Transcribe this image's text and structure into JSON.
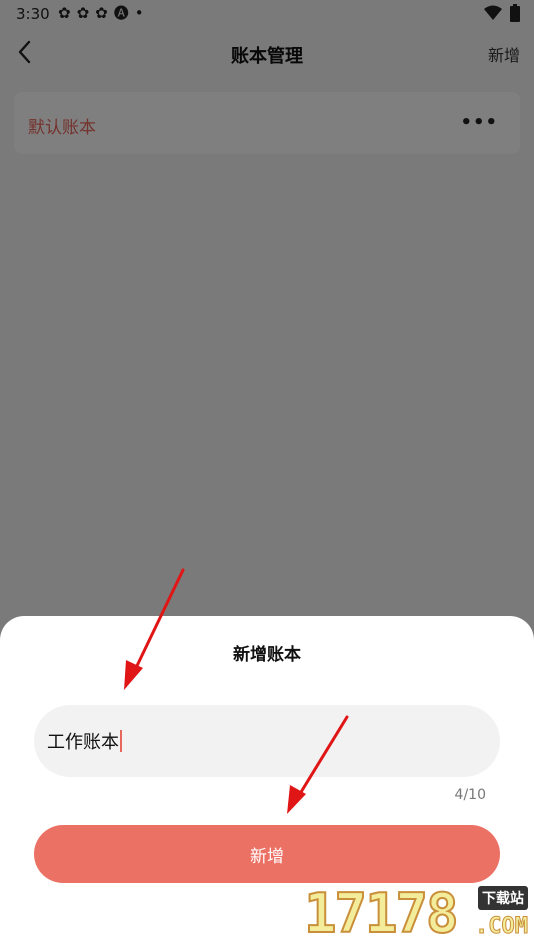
{
  "status_bar": {
    "time": "3:30",
    "left_icons": [
      "status-app-icon",
      "status-app-icon",
      "status-app-icon",
      "status-a-icon",
      "status-dot-icon"
    ],
    "right_icons": [
      "wifi-icon",
      "battery-icon"
    ]
  },
  "nav": {
    "title": "账本管理",
    "action_label": "新增"
  },
  "books": [
    {
      "name": "默认账本"
    }
  ],
  "dialog": {
    "title": "新增账本",
    "input_value": "工作账本",
    "char_count": "4/10",
    "submit_label": "新增"
  },
  "watermark": {
    "digits": "17178",
    "badge": "下载站",
    "suffix": ".COM"
  },
  "colors": {
    "accent": "#ec7165",
    "book_name": "#e8675c",
    "arrow": "#e01515",
    "overlay": "rgba(0,0,0,0.5)"
  }
}
